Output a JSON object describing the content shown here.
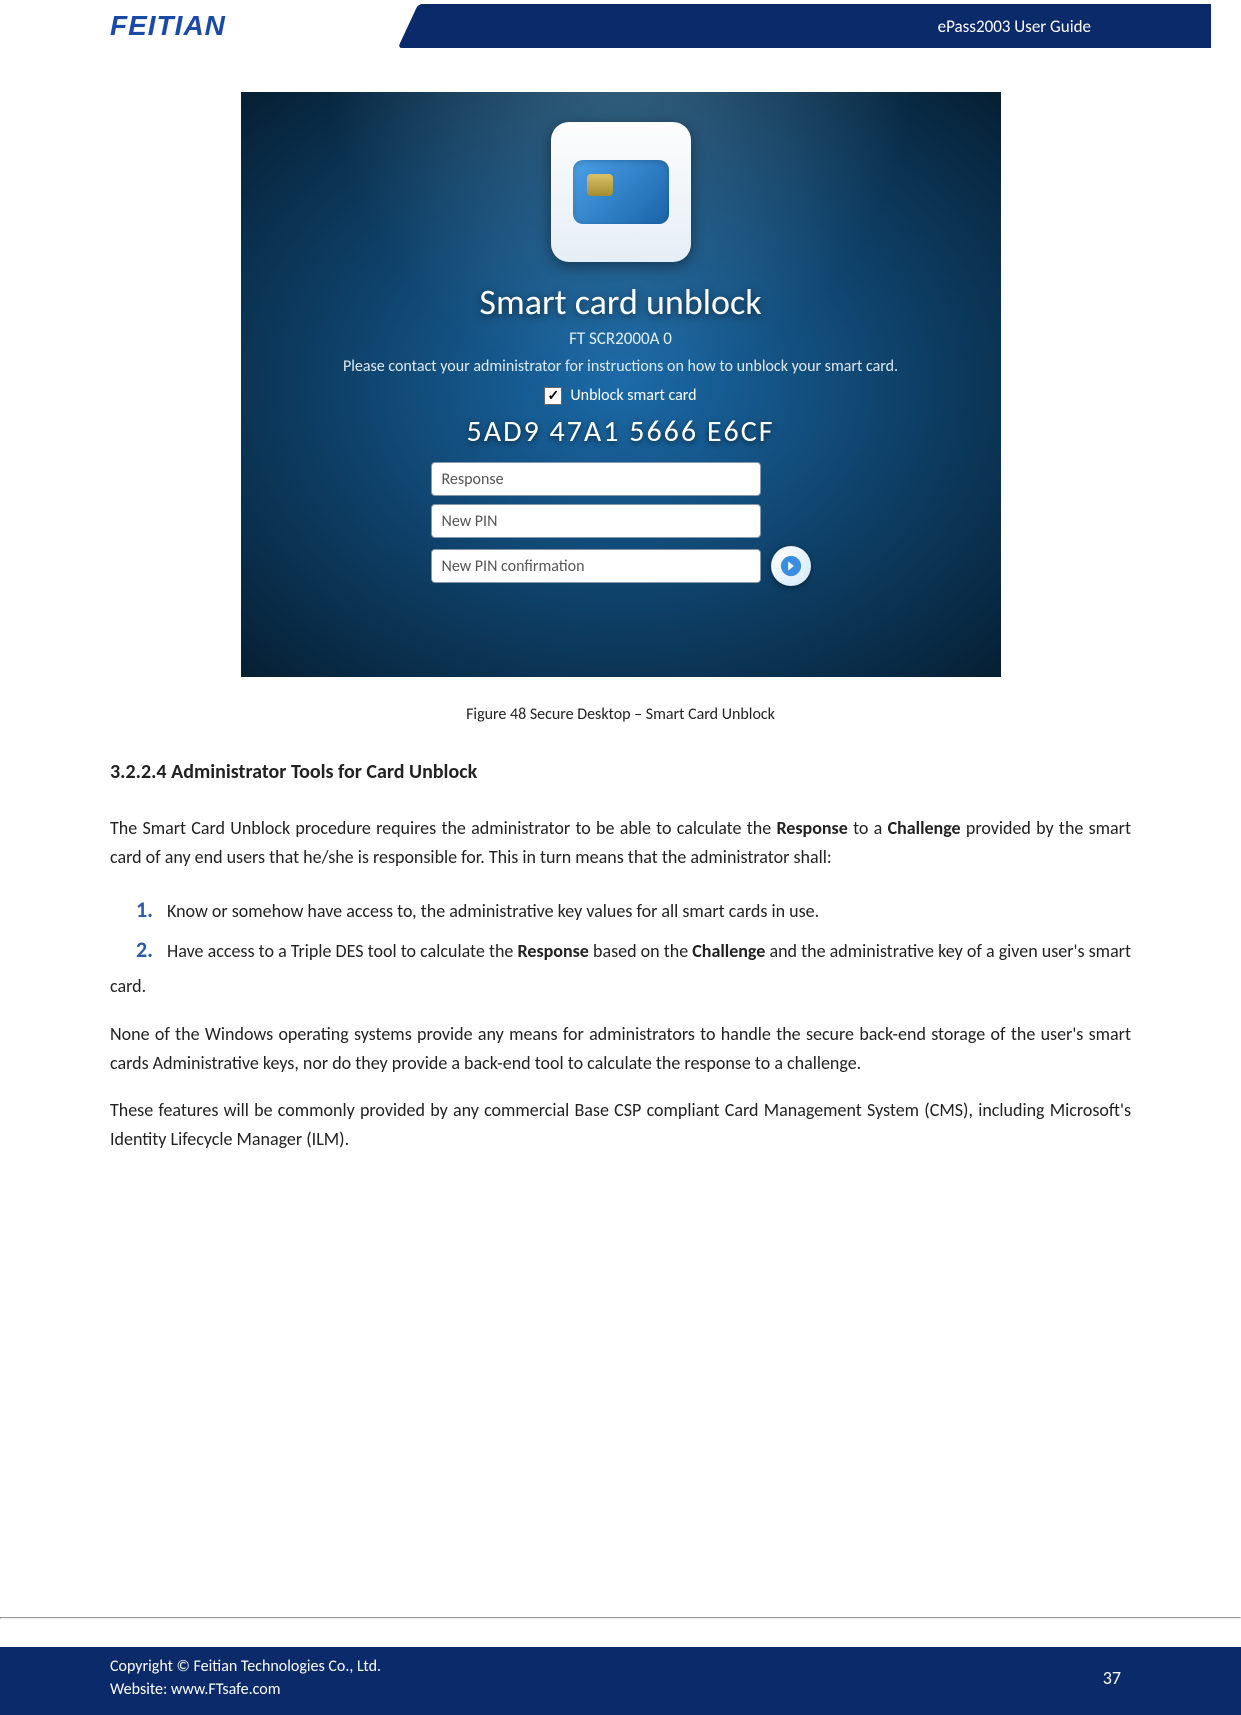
{
  "header": {
    "logo": "FEITIAN",
    "doc_title": "ePass2003  User  Guide"
  },
  "figure": {
    "title": "Smart card unblock",
    "subtitle": "FT SCR2000A 0",
    "hint": "Please contact your administrator for instructions on how to unblock your smart card.",
    "checkbox_label": "Unblock smart card",
    "code": "5AD9 47A1 5666 E6CF",
    "fields": {
      "response": "Response",
      "new_pin": "New PIN",
      "new_pin_conf": "New PIN confirmation"
    },
    "caption": "Figure 48 Secure Desktop – Smart Card Unblock"
  },
  "section": {
    "heading": "3.2.2.4 Administrator Tools for Card Unblock",
    "p1_a": "The Smart Card Unblock procedure requires the administrator to be able to calculate the ",
    "p1_b": "Response",
    "p1_c": " to a ",
    "p1_d": "Challenge",
    "p1_e": " provided by the smart card of any end users that he/she is responsible for. This in turn means that the administrator shall:",
    "li1": "Know or somehow have access to, the administrative key values for all smart cards in use.",
    "li2_a": "Have access to a Triple DES tool to calculate the ",
    "li2_b": "Response",
    "li2_c": " based on the ",
    "li2_d": "Challenge",
    "li2_e": " and the administrative key of a given user's smart card.",
    "p2": "None of the Windows operating systems provide any means for administrators to handle the secure back-end storage of the user's smart cards Administrative keys, nor do they provide a back-end tool to calculate the response to a challenge.",
    "p3": "These features will be commonly provided by any commercial Base CSP compliant Card Management System (CMS), including Microsoft's Identity Lifecycle Manager (ILM)."
  },
  "footer": {
    "copyright": "Copyright © Feitian Technologies Co., Ltd.",
    "website": "Website: www.FTsafe.com",
    "page": "37"
  }
}
